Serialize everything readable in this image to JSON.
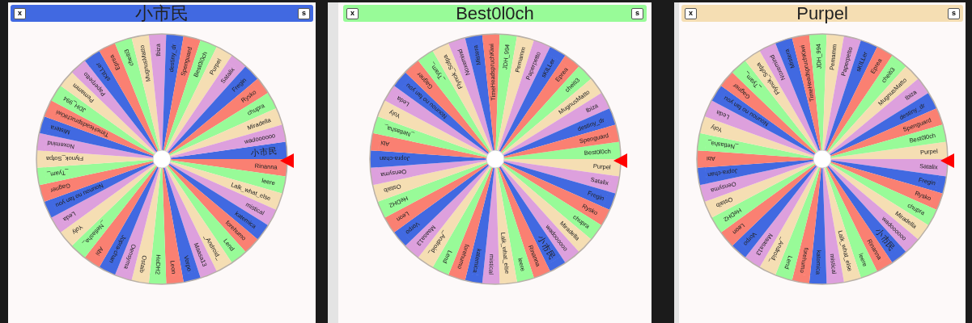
{
  "wheels": [
    {
      "title": "小市民",
      "color": "#4169e1",
      "buttons": [
        "x",
        "s"
      ],
      "segments": [
        {
          "label": "小市民",
          "color": "#4169e1"
        },
        {
          "label": "Rinanna",
          "color": "#fa8072"
        },
        {
          "label": "leere",
          "color": "#98fb98"
        },
        {
          "label": "Lalk_what_else",
          "color": "#f5deb3"
        },
        {
          "label": "mistical",
          "color": "#dda0dd"
        },
        {
          "label": "katemica",
          "color": "#4169e1"
        },
        {
          "label": "forehumo",
          "color": "#fa8072"
        },
        {
          "label": "Lend",
          "color": "#98fb98"
        },
        {
          "label": "_Android_",
          "color": "#f5deb3"
        },
        {
          "label": "Maasa13",
          "color": "#dda0dd"
        },
        {
          "label": "Vorpo",
          "color": "#4169e1"
        },
        {
          "label": "Leon",
          "color": "#fa8072"
        },
        {
          "label": "HeDH2",
          "color": "#98fb98"
        },
        {
          "label": "Ostaib",
          "color": "#f5deb3"
        },
        {
          "label": "Oensyma",
          "color": "#dda0dd"
        },
        {
          "label": "Jopra-chan",
          "color": "#4169e1"
        },
        {
          "label": "Abi",
          "color": "#fa8072"
        },
        {
          "label": "_Netlasha_",
          "color": "#98fb98"
        },
        {
          "label": "Yoly",
          "color": "#f5deb3"
        },
        {
          "label": "Leda",
          "color": "#dda0dd"
        },
        {
          "label": "Nounou no fan you",
          "color": "#4169e1"
        },
        {
          "label": "Gagner",
          "color": "#fa8072"
        },
        {
          "label": "_Tyam_",
          "color": "#98fb98"
        },
        {
          "label": "Flynok_Sofpa",
          "color": "#f5deb3"
        },
        {
          "label": "Noxemind",
          "color": "#dda0dd"
        },
        {
          "label": "Mistera",
          "color": "#4169e1"
        },
        {
          "label": "TimeHeadspruchKiwi",
          "color": "#fa8072"
        },
        {
          "label": "JDH_994",
          "color": "#98fb98"
        },
        {
          "label": "Pemamm",
          "color": "#f5deb3"
        },
        {
          "label": "Paperpetto",
          "color": "#dda0dd"
        },
        {
          "label": "sKILLer",
          "color": "#4169e1"
        },
        {
          "label": "Eprea",
          "color": "#fa8072"
        },
        {
          "label": "cheiti3",
          "color": "#98fb98"
        },
        {
          "label": "MugnusMatto",
          "color": "#f5deb3"
        },
        {
          "label": "Ibiza",
          "color": "#dda0dd"
        },
        {
          "label": "destiny_dr",
          "color": "#4169e1"
        },
        {
          "label": "Spenguard",
          "color": "#fa8072"
        },
        {
          "label": "Best0l0ch",
          "color": "#98fb98"
        },
        {
          "label": "Purpel",
          "color": "#f5deb3"
        },
        {
          "label": "Satalix",
          "color": "#dda0dd"
        },
        {
          "label": "Fregin",
          "color": "#4169e1"
        },
        {
          "label": "Rysko",
          "color": "#fa8072"
        },
        {
          "label": "chupra",
          "color": "#98fb98"
        },
        {
          "label": "Miradella",
          "color": "#f5deb3"
        },
        {
          "label": "wadoooooo",
          "color": "#dda0dd"
        }
      ]
    },
    {
      "title": "Best0l0ch",
      "color": "#98fb98",
      "buttons": [
        "x",
        "s"
      ],
      "segments": [
        {
          "label": "Best0l0ch",
          "color": "#98fb98"
        },
        {
          "label": "Purpel",
          "color": "#f5deb3"
        },
        {
          "label": "Satalix",
          "color": "#dda0dd"
        },
        {
          "label": "Fregin",
          "color": "#4169e1"
        },
        {
          "label": "Rysko",
          "color": "#fa8072"
        },
        {
          "label": "chupra",
          "color": "#98fb98"
        },
        {
          "label": "Miradella",
          "color": "#f5deb3"
        },
        {
          "label": "wadoooooo",
          "color": "#dda0dd"
        },
        {
          "label": "小市民",
          "color": "#4169e1"
        },
        {
          "label": "Rinanna",
          "color": "#fa8072"
        },
        {
          "label": "leere",
          "color": "#98fb98"
        },
        {
          "label": "Lalk_what_else",
          "color": "#f5deb3"
        },
        {
          "label": "mistical",
          "color": "#dda0dd"
        },
        {
          "label": "katemica",
          "color": "#4169e1"
        },
        {
          "label": "forehumo",
          "color": "#fa8072"
        },
        {
          "label": "Lend",
          "color": "#98fb98"
        },
        {
          "label": "_Android_",
          "color": "#f5deb3"
        },
        {
          "label": "Maasa13",
          "color": "#dda0dd"
        },
        {
          "label": "Vorpo",
          "color": "#4169e1"
        },
        {
          "label": "Leon",
          "color": "#fa8072"
        },
        {
          "label": "HeDH2",
          "color": "#98fb98"
        },
        {
          "label": "Ostaib",
          "color": "#f5deb3"
        },
        {
          "label": "Oensyma",
          "color": "#dda0dd"
        },
        {
          "label": "Jopra-chan",
          "color": "#4169e1"
        },
        {
          "label": "Abi",
          "color": "#fa8072"
        },
        {
          "label": "_Netlasha_",
          "color": "#98fb98"
        },
        {
          "label": "Yoly",
          "color": "#f5deb3"
        },
        {
          "label": "Leda",
          "color": "#dda0dd"
        },
        {
          "label": "Nounou no fan you",
          "color": "#4169e1"
        },
        {
          "label": "Gagner",
          "color": "#fa8072"
        },
        {
          "label": "_Tyam_",
          "color": "#98fb98"
        },
        {
          "label": "Flynok_Sofpa",
          "color": "#f5deb3"
        },
        {
          "label": "Noxemind",
          "color": "#dda0dd"
        },
        {
          "label": "Mistera",
          "color": "#4169e1"
        },
        {
          "label": "TimeHeadspruchKiwi",
          "color": "#fa8072"
        },
        {
          "label": "JDH_994",
          "color": "#98fb98"
        },
        {
          "label": "Pemamm",
          "color": "#f5deb3"
        },
        {
          "label": "Paperpetto",
          "color": "#dda0dd"
        },
        {
          "label": "sKILLer",
          "color": "#4169e1"
        },
        {
          "label": "Eprea",
          "color": "#fa8072"
        },
        {
          "label": "cheiti3",
          "color": "#98fb98"
        },
        {
          "label": "MugnusMatto",
          "color": "#f5deb3"
        },
        {
          "label": "Ibiza",
          "color": "#dda0dd"
        },
        {
          "label": "destiny_dr",
          "color": "#4169e1"
        },
        {
          "label": "Spenguard",
          "color": "#fa8072"
        }
      ]
    },
    {
      "title": "Purpel",
      "color": "#f5deb3",
      "buttons": [
        "x",
        "s"
      ],
      "segments": [
        {
          "label": "Purpel",
          "color": "#f5deb3"
        },
        {
          "label": "Satalix",
          "color": "#dda0dd"
        },
        {
          "label": "Fregin",
          "color": "#4169e1"
        },
        {
          "label": "Rysko",
          "color": "#fa8072"
        },
        {
          "label": "chupra",
          "color": "#98fb98"
        },
        {
          "label": "Miradella",
          "color": "#f5deb3"
        },
        {
          "label": "wadoooooo",
          "color": "#dda0dd"
        },
        {
          "label": "小市民",
          "color": "#4169e1"
        },
        {
          "label": "Rinanna",
          "color": "#fa8072"
        },
        {
          "label": "leere",
          "color": "#98fb98"
        },
        {
          "label": "Lalk_what_else",
          "color": "#f5deb3"
        },
        {
          "label": "mistical",
          "color": "#dda0dd"
        },
        {
          "label": "katemica",
          "color": "#4169e1"
        },
        {
          "label": "forehumo",
          "color": "#fa8072"
        },
        {
          "label": "Lend",
          "color": "#98fb98"
        },
        {
          "label": "_Android_",
          "color": "#f5deb3"
        },
        {
          "label": "Maasa13",
          "color": "#dda0dd"
        },
        {
          "label": "Vorpo",
          "color": "#4169e1"
        },
        {
          "label": "Leon",
          "color": "#fa8072"
        },
        {
          "label": "HeDH2",
          "color": "#98fb98"
        },
        {
          "label": "Ostaib",
          "color": "#f5deb3"
        },
        {
          "label": "Oensyma",
          "color": "#dda0dd"
        },
        {
          "label": "Jopra-chan",
          "color": "#4169e1"
        },
        {
          "label": "Abi",
          "color": "#fa8072"
        },
        {
          "label": "_Netlasha_",
          "color": "#98fb98"
        },
        {
          "label": "Yoly",
          "color": "#f5deb3"
        },
        {
          "label": "Leda",
          "color": "#dda0dd"
        },
        {
          "label": "Nounou no fan you",
          "color": "#4169e1"
        },
        {
          "label": "Gagner",
          "color": "#fa8072"
        },
        {
          "label": "_Tyam_",
          "color": "#98fb98"
        },
        {
          "label": "Flynok_Sofpa",
          "color": "#f5deb3"
        },
        {
          "label": "Noxemind",
          "color": "#dda0dd"
        },
        {
          "label": "Mistera",
          "color": "#4169e1"
        },
        {
          "label": "TimeHeadspruchKiwi",
          "color": "#fa8072"
        },
        {
          "label": "JDH_994",
          "color": "#98fb98"
        },
        {
          "label": "Pemamm",
          "color": "#f5deb3"
        },
        {
          "label": "Paperpetto",
          "color": "#dda0dd"
        },
        {
          "label": "sKILLer",
          "color": "#4169e1"
        },
        {
          "label": "Eprea",
          "color": "#fa8072"
        },
        {
          "label": "cheiti3",
          "color": "#98fb98"
        },
        {
          "label": "MugnusMatto",
          "color": "#f5deb3"
        },
        {
          "label": "Ibiza",
          "color": "#dda0dd"
        },
        {
          "label": "destiny_dr",
          "color": "#4169e1"
        },
        {
          "label": "Spenguard",
          "color": "#fa8072"
        },
        {
          "label": "Best0l0ch",
          "color": "#98fb98"
        }
      ]
    }
  ]
}
